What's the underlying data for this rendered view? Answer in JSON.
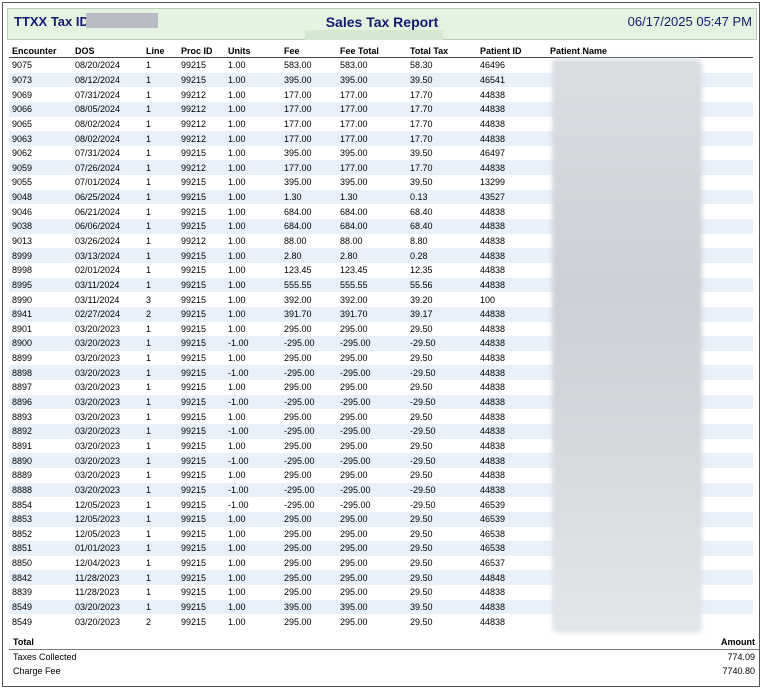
{
  "header": {
    "tax_id_label": "TTXX Tax ID:",
    "report_title": "Sales Tax Report",
    "timestamp": "06/17/2025 05:47 PM"
  },
  "columns": [
    "Encounter",
    "DOS",
    "Line",
    "Proc ID",
    "Units",
    "Fee",
    "Fee Total",
    "Total Tax",
    "Patient ID",
    "Patient Name"
  ],
  "rows": [
    {
      "encounter": "9075",
      "dos": "08/20/2024",
      "line": "1",
      "proc": "99215",
      "units": "1.00",
      "fee": "583.00",
      "fee_total": "583.00",
      "tax": "58.30",
      "patient_id": "46496"
    },
    {
      "encounter": "9073",
      "dos": "08/12/2024",
      "line": "1",
      "proc": "99215",
      "units": "1.00",
      "fee": "395.00",
      "fee_total": "395.00",
      "tax": "39.50",
      "patient_id": "46541"
    },
    {
      "encounter": "9069",
      "dos": "07/31/2024",
      "line": "1",
      "proc": "99212",
      "units": "1.00",
      "fee": "177.00",
      "fee_total": "177.00",
      "tax": "17.70",
      "patient_id": "44838"
    },
    {
      "encounter": "9066",
      "dos": "08/05/2024",
      "line": "1",
      "proc": "99212",
      "units": "1.00",
      "fee": "177.00",
      "fee_total": "177.00",
      "tax": "17.70",
      "patient_id": "44838"
    },
    {
      "encounter": "9065",
      "dos": "08/02/2024",
      "line": "1",
      "proc": "99212",
      "units": "1.00",
      "fee": "177.00",
      "fee_total": "177.00",
      "tax": "17.70",
      "patient_id": "44838"
    },
    {
      "encounter": "9063",
      "dos": "08/02/2024",
      "line": "1",
      "proc": "99212",
      "units": "1.00",
      "fee": "177.00",
      "fee_total": "177.00",
      "tax": "17.70",
      "patient_id": "44838"
    },
    {
      "encounter": "9062",
      "dos": "07/31/2024",
      "line": "1",
      "proc": "99215",
      "units": "1.00",
      "fee": "395.00",
      "fee_total": "395.00",
      "tax": "39.50",
      "patient_id": "46497"
    },
    {
      "encounter": "9059",
      "dos": "07/26/2024",
      "line": "1",
      "proc": "99212",
      "units": "1.00",
      "fee": "177.00",
      "fee_total": "177.00",
      "tax": "17.70",
      "patient_id": "44838"
    },
    {
      "encounter": "9055",
      "dos": "07/01/2024",
      "line": "1",
      "proc": "99215",
      "units": "1.00",
      "fee": "395.00",
      "fee_total": "395.00",
      "tax": "39.50",
      "patient_id": "13299"
    },
    {
      "encounter": "9048",
      "dos": "06/25/2024",
      "line": "1",
      "proc": "99215",
      "units": "1.00",
      "fee": "1.30",
      "fee_total": "1.30",
      "tax": "0.13",
      "patient_id": "43527"
    },
    {
      "encounter": "9046",
      "dos": "06/21/2024",
      "line": "1",
      "proc": "99215",
      "units": "1.00",
      "fee": "684.00",
      "fee_total": "684.00",
      "tax": "68.40",
      "patient_id": "44838"
    },
    {
      "encounter": "9038",
      "dos": "06/06/2024",
      "line": "1",
      "proc": "99215",
      "units": "1.00",
      "fee": "684.00",
      "fee_total": "684.00",
      "tax": "68.40",
      "patient_id": "44838"
    },
    {
      "encounter": "9013",
      "dos": "03/26/2024",
      "line": "1",
      "proc": "99212",
      "units": "1.00",
      "fee": "88.00",
      "fee_total": "88.00",
      "tax": "8.80",
      "patient_id": "44838"
    },
    {
      "encounter": "8999",
      "dos": "03/13/2024",
      "line": "1",
      "proc": "99215",
      "units": "1.00",
      "fee": "2.80",
      "fee_total": "2.80",
      "tax": "0.28",
      "patient_id": "44838"
    },
    {
      "encounter": "8998",
      "dos": "02/01/2024",
      "line": "1",
      "proc": "99215",
      "units": "1.00",
      "fee": "123.45",
      "fee_total": "123.45",
      "tax": "12.35",
      "patient_id": "44838"
    },
    {
      "encounter": "8995",
      "dos": "03/11/2024",
      "line": "1",
      "proc": "99215",
      "units": "1.00",
      "fee": "555.55",
      "fee_total": "555.55",
      "tax": "55.56",
      "patient_id": "44838"
    },
    {
      "encounter": "8990",
      "dos": "03/11/2024",
      "line": "3",
      "proc": "99215",
      "units": "1.00",
      "fee": "392.00",
      "fee_total": "392.00",
      "tax": "39.20",
      "patient_id": "100"
    },
    {
      "encounter": "8941",
      "dos": "02/27/2024",
      "line": "2",
      "proc": "99215",
      "units": "1.00",
      "fee": "391.70",
      "fee_total": "391.70",
      "tax": "39.17",
      "patient_id": "44838"
    },
    {
      "encounter": "8901",
      "dos": "03/20/2023",
      "line": "1",
      "proc": "99215",
      "units": "1.00",
      "fee": "295.00",
      "fee_total": "295.00",
      "tax": "29.50",
      "patient_id": "44838"
    },
    {
      "encounter": "8900",
      "dos": "03/20/2023",
      "line": "1",
      "proc": "99215",
      "units": "-1.00",
      "fee": "-295.00",
      "fee_total": "-295.00",
      "tax": "-29.50",
      "patient_id": "44838"
    },
    {
      "encounter": "8899",
      "dos": "03/20/2023",
      "line": "1",
      "proc": "99215",
      "units": "1.00",
      "fee": "295.00",
      "fee_total": "295.00",
      "tax": "29.50",
      "patient_id": "44838"
    },
    {
      "encounter": "8898",
      "dos": "03/20/2023",
      "line": "1",
      "proc": "99215",
      "units": "-1.00",
      "fee": "-295.00",
      "fee_total": "-295.00",
      "tax": "-29.50",
      "patient_id": "44838"
    },
    {
      "encounter": "8897",
      "dos": "03/20/2023",
      "line": "1",
      "proc": "99215",
      "units": "1.00",
      "fee": "295.00",
      "fee_total": "295.00",
      "tax": "29.50",
      "patient_id": "44838"
    },
    {
      "encounter": "8896",
      "dos": "03/20/2023",
      "line": "1",
      "proc": "99215",
      "units": "-1.00",
      "fee": "-295.00",
      "fee_total": "-295.00",
      "tax": "-29.50",
      "patient_id": "44838"
    },
    {
      "encounter": "8893",
      "dos": "03/20/2023",
      "line": "1",
      "proc": "99215",
      "units": "1.00",
      "fee": "295.00",
      "fee_total": "295.00",
      "tax": "29.50",
      "patient_id": "44838"
    },
    {
      "encounter": "8892",
      "dos": "03/20/2023",
      "line": "1",
      "proc": "99215",
      "units": "-1.00",
      "fee": "-295.00",
      "fee_total": "-295.00",
      "tax": "-29.50",
      "patient_id": "44838"
    },
    {
      "encounter": "8891",
      "dos": "03/20/2023",
      "line": "1",
      "proc": "99215",
      "units": "1.00",
      "fee": "295.00",
      "fee_total": "295.00",
      "tax": "29.50",
      "patient_id": "44838"
    },
    {
      "encounter": "8890",
      "dos": "03/20/2023",
      "line": "1",
      "proc": "99215",
      "units": "-1.00",
      "fee": "-295.00",
      "fee_total": "-295.00",
      "tax": "-29.50",
      "patient_id": "44838"
    },
    {
      "encounter": "8889",
      "dos": "03/20/2023",
      "line": "1",
      "proc": "99215",
      "units": "1.00",
      "fee": "295.00",
      "fee_total": "295.00",
      "tax": "29.50",
      "patient_id": "44838"
    },
    {
      "encounter": "8888",
      "dos": "03/20/2023",
      "line": "1",
      "proc": "99215",
      "units": "-1.00",
      "fee": "-295.00",
      "fee_total": "-295.00",
      "tax": "-29.50",
      "patient_id": "44838"
    },
    {
      "encounter": "8854",
      "dos": "12/05/2023",
      "line": "1",
      "proc": "99215",
      "units": "-1.00",
      "fee": "-295.00",
      "fee_total": "-295.00",
      "tax": "-29.50",
      "patient_id": "46539"
    },
    {
      "encounter": "8853",
      "dos": "12/05/2023",
      "line": "1",
      "proc": "99215",
      "units": "1.00",
      "fee": "295.00",
      "fee_total": "295.00",
      "tax": "29.50",
      "patient_id": "46539"
    },
    {
      "encounter": "8852",
      "dos": "12/05/2023",
      "line": "1",
      "proc": "99215",
      "units": "1.00",
      "fee": "295.00",
      "fee_total": "295.00",
      "tax": "29.50",
      "patient_id": "46538"
    },
    {
      "encounter": "8851",
      "dos": "01/01/2023",
      "line": "1",
      "proc": "99215",
      "units": "1.00",
      "fee": "295.00",
      "fee_total": "295.00",
      "tax": "29.50",
      "patient_id": "46538"
    },
    {
      "encounter": "8850",
      "dos": "12/04/2023",
      "line": "1",
      "proc": "99215",
      "units": "1.00",
      "fee": "295.00",
      "fee_total": "295.00",
      "tax": "29.50",
      "patient_id": "46537"
    },
    {
      "encounter": "8842",
      "dos": "11/28/2023",
      "line": "1",
      "proc": "99215",
      "units": "1.00",
      "fee": "295.00",
      "fee_total": "295.00",
      "tax": "29.50",
      "patient_id": "44848"
    },
    {
      "encounter": "8839",
      "dos": "11/28/2023",
      "line": "1",
      "proc": "99215",
      "units": "1.00",
      "fee": "295.00",
      "fee_total": "295.00",
      "tax": "29.50",
      "patient_id": "44838"
    },
    {
      "encounter": "8549",
      "dos": "03/20/2023",
      "line": "1",
      "proc": "99215",
      "units": "1.00",
      "fee": "395.00",
      "fee_total": "395.00",
      "tax": "39.50",
      "patient_id": "44838"
    },
    {
      "encounter": "8549",
      "dos": "03/20/2023",
      "line": "2",
      "proc": "99215",
      "units": "1.00",
      "fee": "295.00",
      "fee_total": "295.00",
      "tax": "29.50",
      "patient_id": "44838"
    }
  ],
  "footer": {
    "total_label": "Total",
    "amount_label": "Amount",
    "taxes_collected_label": "Taxes Collected",
    "taxes_collected_value": "774.09",
    "charge_fee_label": "Charge Fee",
    "charge_fee_value": "7740.80"
  }
}
